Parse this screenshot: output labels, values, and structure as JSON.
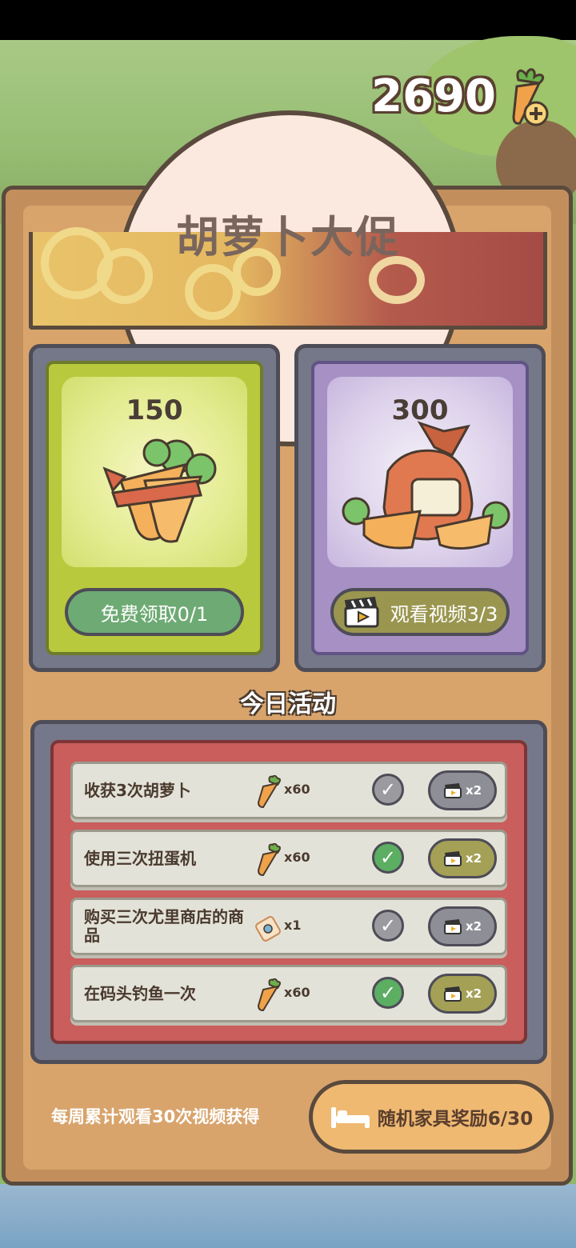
{
  "currency": {
    "value": "2690",
    "icon": "carrot-add-icon"
  },
  "title": "胡萝卜大促",
  "offers": [
    {
      "price": "150",
      "button_label": "免费领取0/1",
      "icon": "carrot-bundle-icon"
    },
    {
      "price": "300",
      "button_label": "观看视频3/3",
      "icon": "carrot-sack-icon",
      "button_icon": "clapperboard-icon"
    }
  ],
  "today_section": {
    "title": "今日活动"
  },
  "tasks": [
    {
      "label": "收获3次胡萝卜",
      "reward_icon": "carrot-icon",
      "reward_qty": "x60",
      "completed": false,
      "video_multiplier": "x2"
    },
    {
      "label": "使用三次扭蛋机",
      "reward_icon": "carrot-icon",
      "reward_qty": "x60",
      "completed": true,
      "video_multiplier": "x2"
    },
    {
      "label": "购买三次尤里商店的商品",
      "reward_icon": "ticket-icon",
      "reward_qty": "x1",
      "completed": false,
      "video_multiplier": "x2"
    },
    {
      "label": "在码头钓鱼一次",
      "reward_icon": "carrot-icon",
      "reward_qty": "x60",
      "completed": true,
      "video_multiplier": "x2"
    }
  ],
  "weekly": {
    "description": "每周累计观看30次视频获得",
    "button_label": "随机家具奖励6/30",
    "button_icon": "bed-icon"
  },
  "colors": {
    "check_done": "#5bae62",
    "check_pending": "#9b9a9f",
    "accent_orange": "#efb972"
  }
}
